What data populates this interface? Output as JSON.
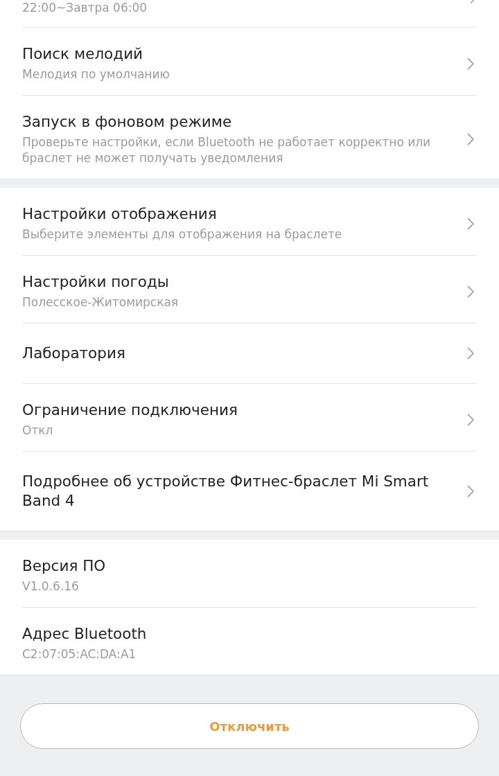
{
  "sections": [
    {
      "items": [
        {
          "kind": "cut",
          "subtitle": "22:00~Завтра 06:00"
        },
        {
          "kind": "nav",
          "title": "Поиск мелодий",
          "subtitle": "Мелодия по умолчанию"
        },
        {
          "kind": "nav",
          "title": "Запуск в фоновом режиме",
          "subtitle": "Проверьте настройки, если Bluetooth не работает корректно или браслет не может получать уведомления"
        }
      ]
    },
    {
      "items": [
        {
          "kind": "nav",
          "title": "Настройки отображения",
          "subtitle": "Выберите элементы для отображения на браслете"
        },
        {
          "kind": "nav",
          "title": "Настройки погоды",
          "subtitle": "Полесское-Житомирская"
        },
        {
          "kind": "nav",
          "title": "Лаборатория"
        },
        {
          "kind": "nav",
          "title": "Ограничение подключения",
          "subtitle": "Откл"
        },
        {
          "kind": "nav",
          "title": "Подробнее об устройстве Фитнес-браслет Mi Smart Band 4"
        }
      ]
    },
    {
      "items": [
        {
          "kind": "info",
          "title": "Версия ПО",
          "subtitle": "V1.0.6.16"
        },
        {
          "kind": "info",
          "title": "Адрес Bluetooth",
          "subtitle": "C2:07:05:AC:DA:A1"
        }
      ]
    }
  ],
  "disconnect_button": {
    "label": "Отключить"
  }
}
